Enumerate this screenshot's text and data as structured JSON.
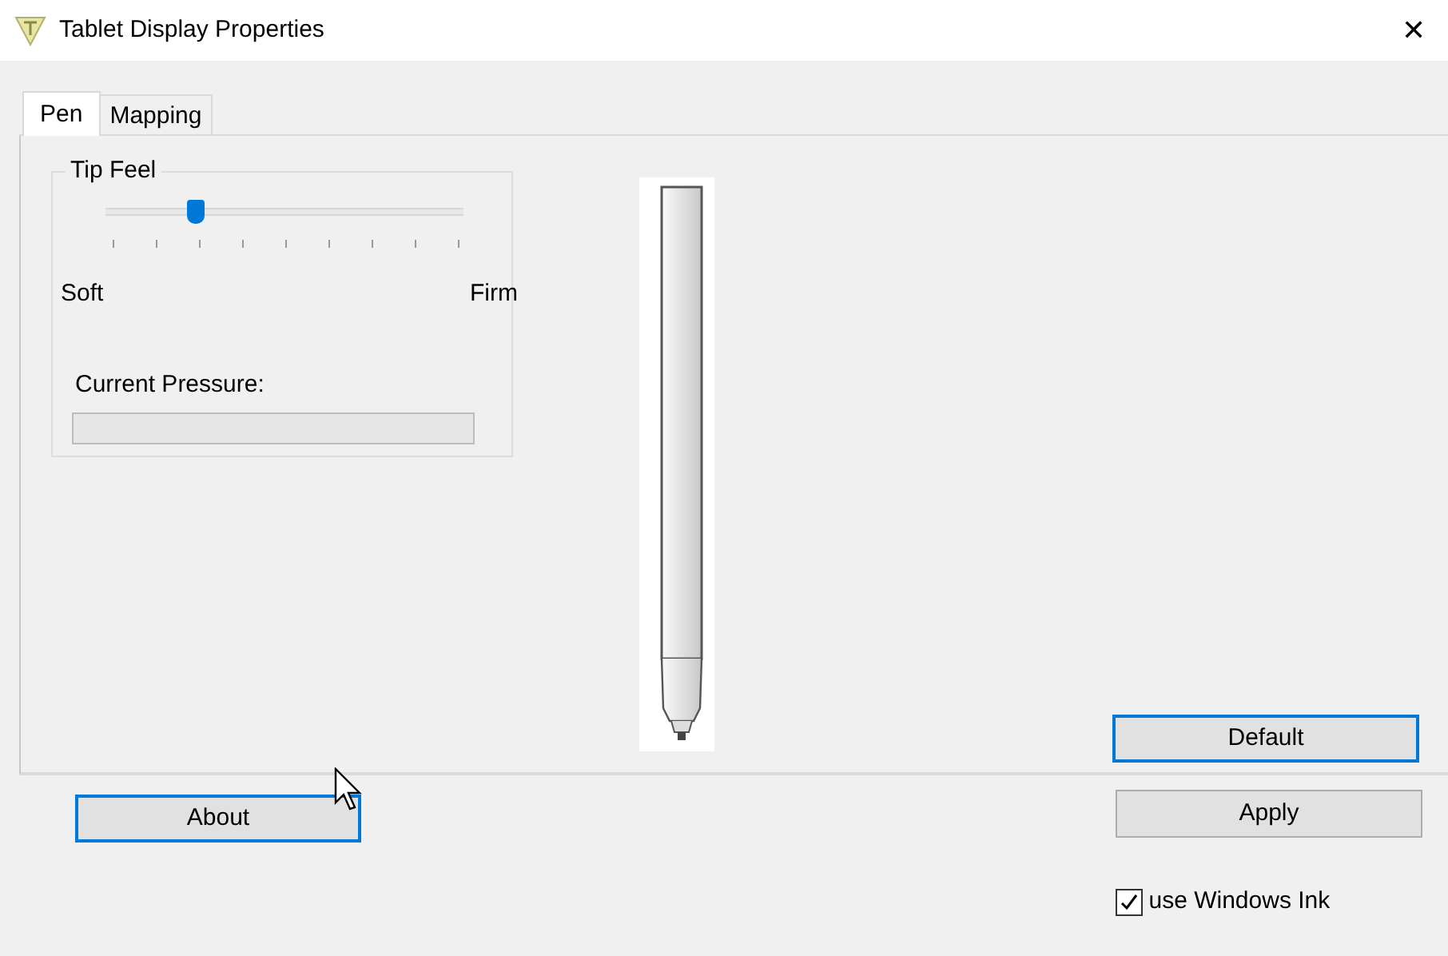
{
  "window": {
    "title": "Tablet Display Properties",
    "close": "✕"
  },
  "tabs": [
    {
      "label": "Pen",
      "selected": true
    },
    {
      "label": "Mapping",
      "selected": false
    }
  ],
  "tip_feel": {
    "title": "Tip Feel",
    "slider": {
      "level": 0.25
    },
    "min_label": "Soft",
    "max_label": "Firm",
    "pressure_label": "Current Pressure:"
  },
  "default_button": {
    "label": "Default",
    "highlighted": true
  },
  "about_button": {
    "label": "About",
    "highlighted": true
  },
  "apply_button": {
    "label": "Apply",
    "highlighted": false
  },
  "windows_ink": {
    "label": "use Windows Ink",
    "checked": true
  }
}
